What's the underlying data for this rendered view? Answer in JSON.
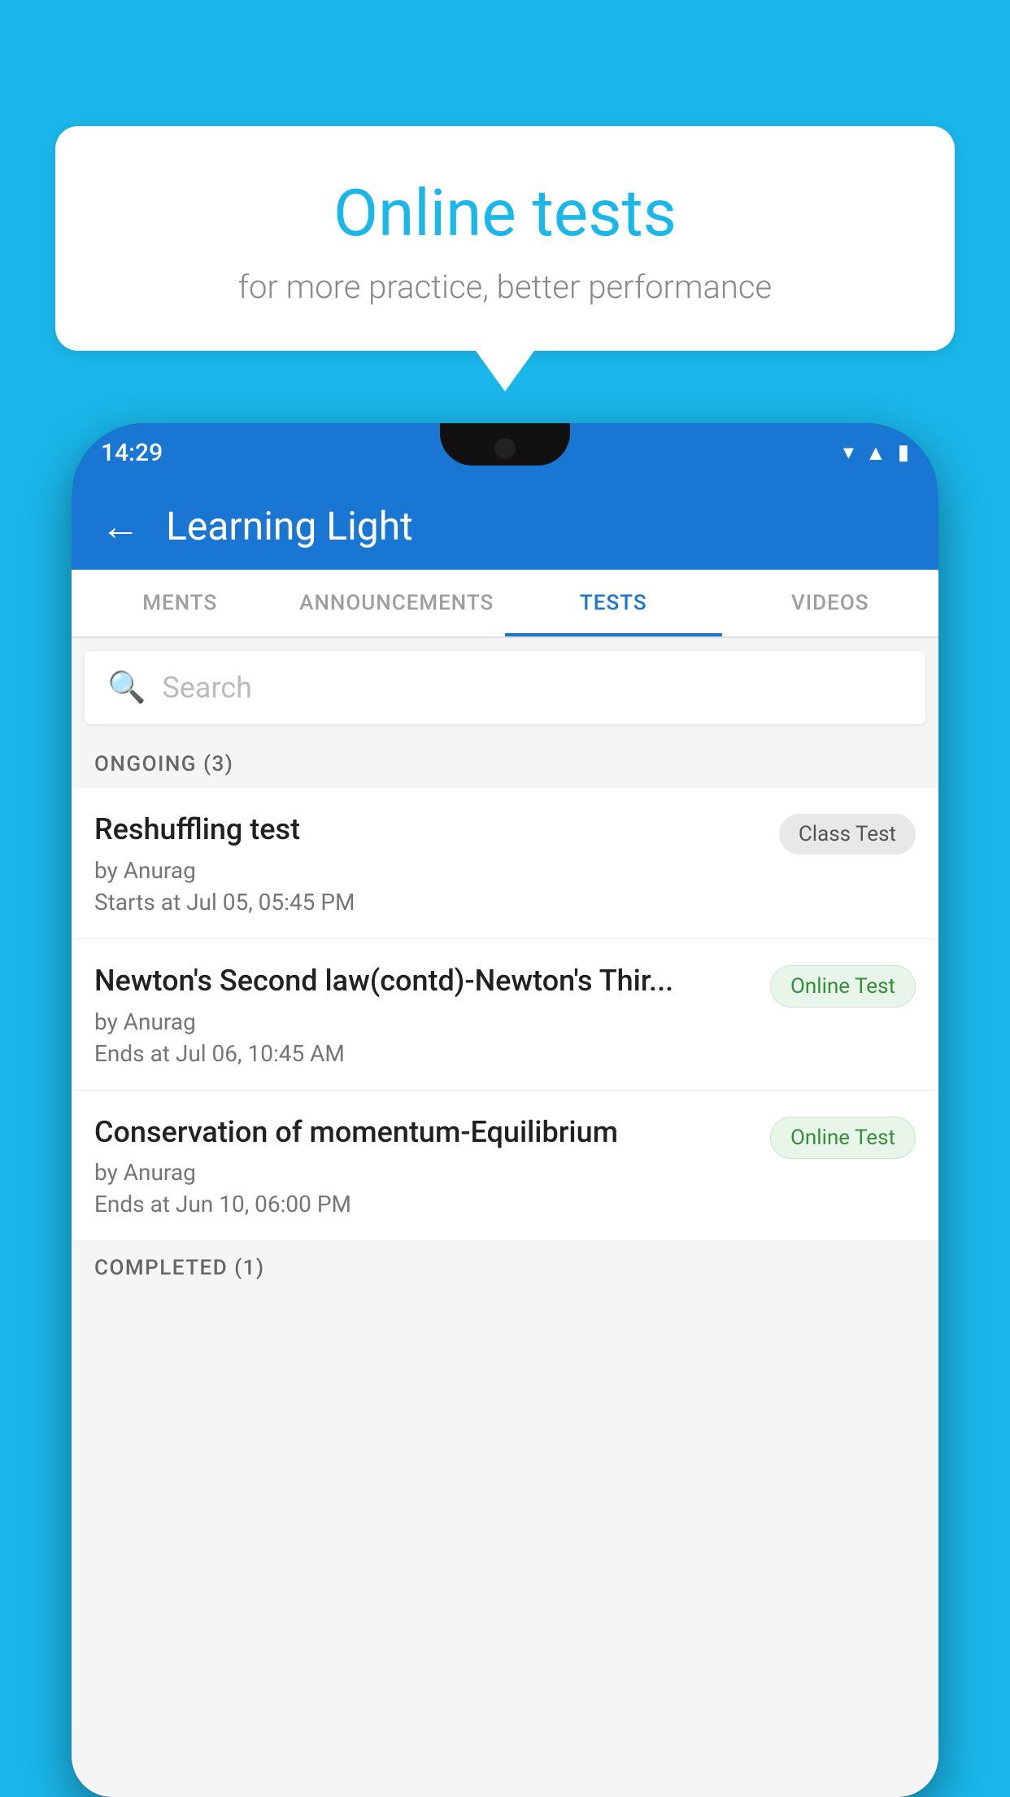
{
  "background_color": "#1ab7ea",
  "speech_bubble": {
    "title": "Online tests",
    "subtitle": "for more practice, better performance"
  },
  "phone": {
    "status_bar": {
      "time": "14:29",
      "icons": [
        "wifi",
        "signal",
        "battery"
      ]
    },
    "app_bar": {
      "title": "Learning Light",
      "back_label": "←"
    },
    "tabs": [
      {
        "label": "MENTS",
        "active": false
      },
      {
        "label": "ANNOUNCEMENTS",
        "active": false
      },
      {
        "label": "TESTS",
        "active": true
      },
      {
        "label": "VIDEOS",
        "active": false
      }
    ],
    "search": {
      "placeholder": "Search"
    },
    "sections": [
      {
        "header": "ONGOING (3)",
        "tests": [
          {
            "name": "Reshuffling test",
            "author": "by Anurag",
            "date_label": "Starts at",
            "date": "Jul 05, 05:45 PM",
            "badge": "Class Test",
            "badge_type": "class"
          },
          {
            "name": "Newton's Second law(contd)-Newton's Thir...",
            "author": "by Anurag",
            "date_label": "Ends at",
            "date": "Jul 06, 10:45 AM",
            "badge": "Online Test",
            "badge_type": "online"
          },
          {
            "name": "Conservation of momentum-Equilibrium",
            "author": "by Anurag",
            "date_label": "Ends at",
            "date": "Jun 10, 06:00 PM",
            "badge": "Online Test",
            "badge_type": "online"
          }
        ]
      }
    ],
    "completed_section_label": "COMPLETED (1)"
  }
}
